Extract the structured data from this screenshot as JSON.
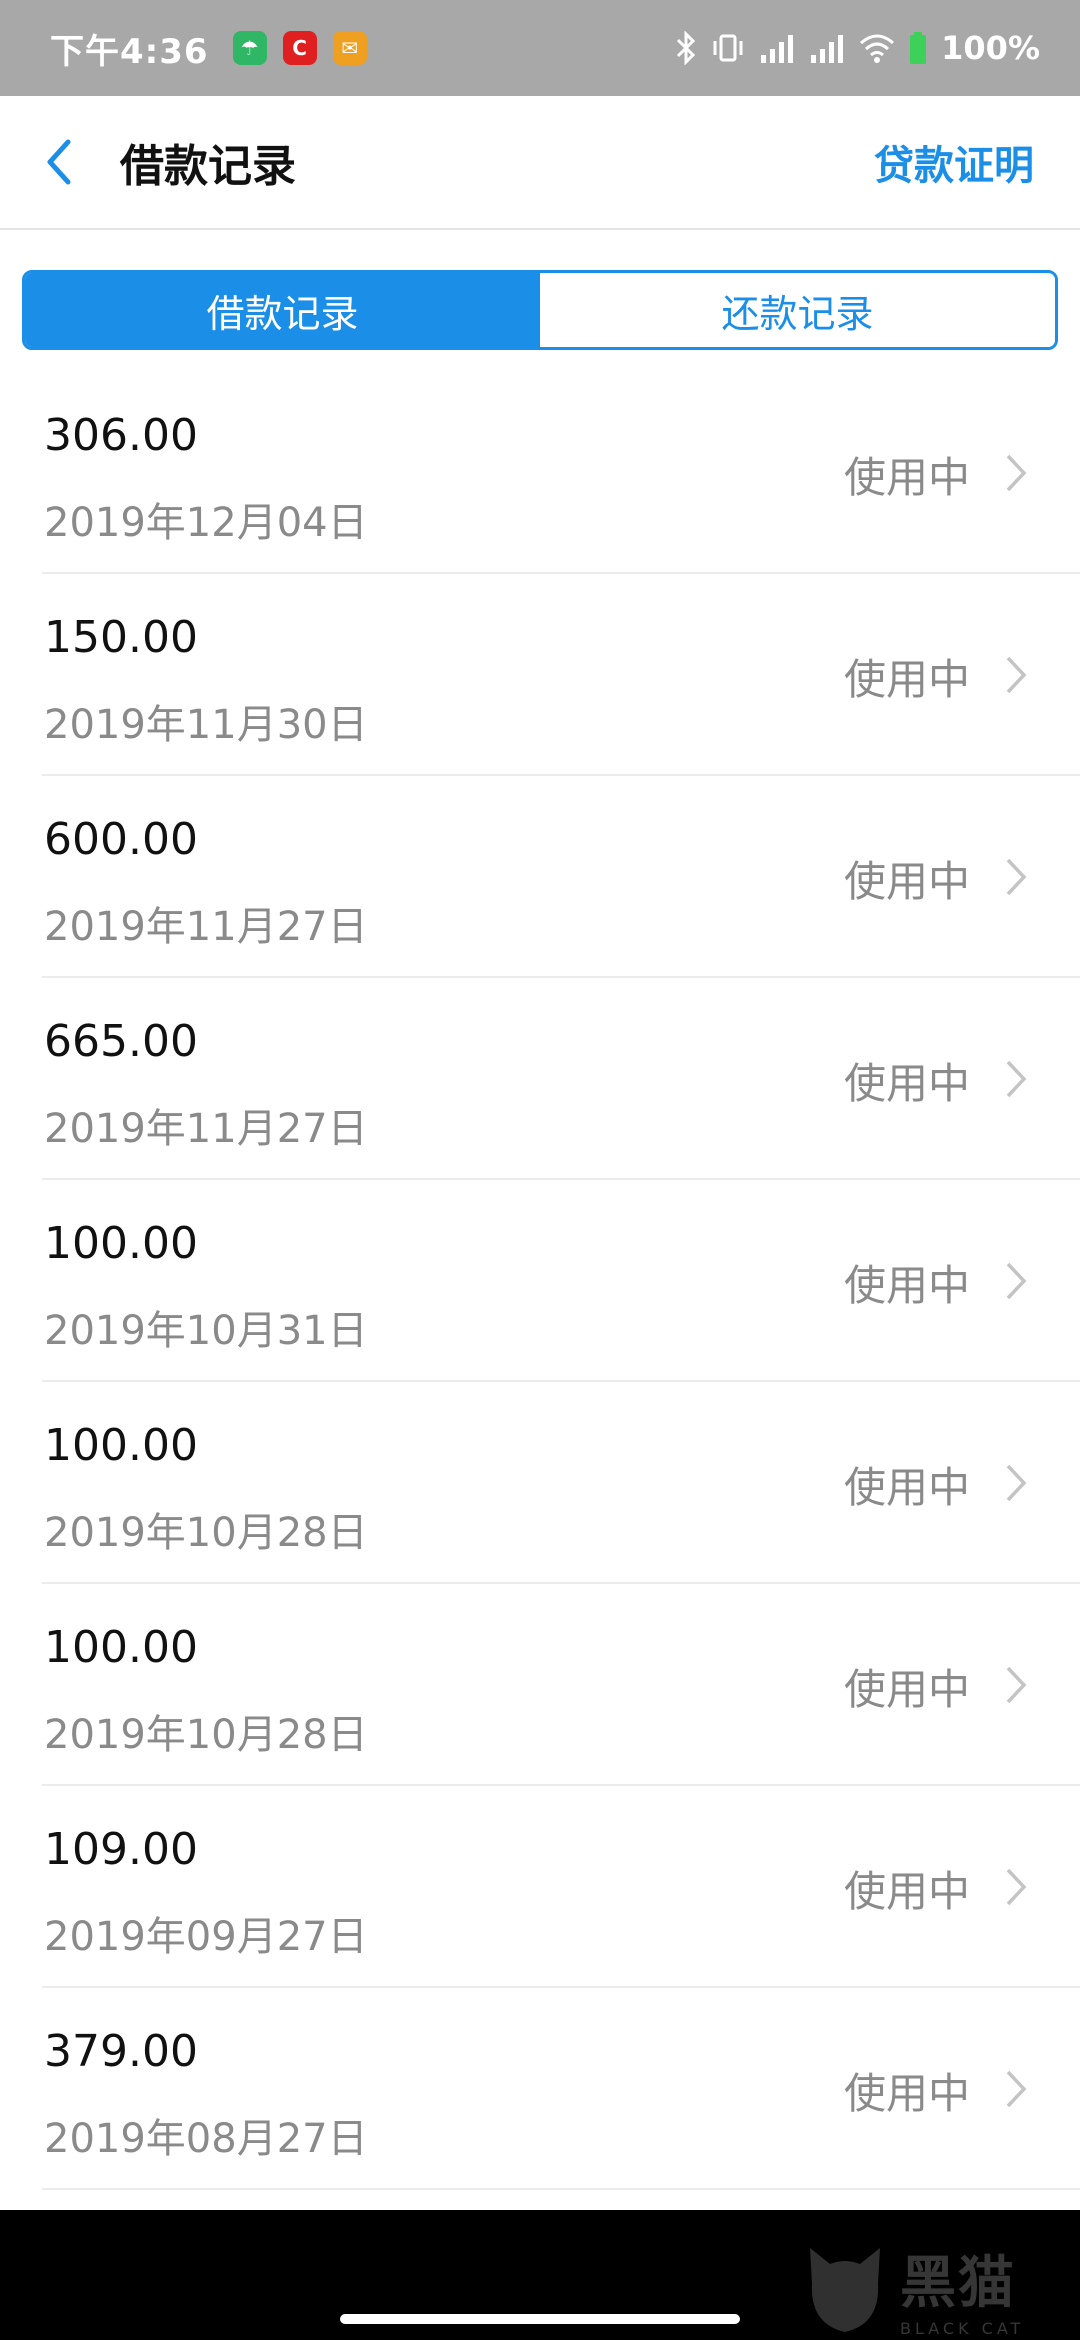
{
  "status_bar": {
    "time": "下午4:36",
    "battery": "100%",
    "apps": [
      {
        "icon": "umbrella-app-icon",
        "color": "#2fb765",
        "glyph": "☂"
      },
      {
        "icon": "c-app-icon",
        "color": "#e02020",
        "glyph": "C"
      },
      {
        "icon": "mail-app-icon",
        "color": "#f0a020",
        "glyph": "✉"
      }
    ]
  },
  "header": {
    "title": "借款记录",
    "action": "贷款证明"
  },
  "tabs": [
    {
      "label": "借款记录",
      "active": true
    },
    {
      "label": "还款记录",
      "active": false
    }
  ],
  "records": [
    {
      "amount": "306.00",
      "date": "2019年12月04日",
      "status": "使用中"
    },
    {
      "amount": "150.00",
      "date": "2019年11月30日",
      "status": "使用中"
    },
    {
      "amount": "600.00",
      "date": "2019年11月27日",
      "status": "使用中"
    },
    {
      "amount": "665.00",
      "date": "2019年11月27日",
      "status": "使用中"
    },
    {
      "amount": "100.00",
      "date": "2019年10月31日",
      "status": "使用中"
    },
    {
      "amount": "100.00",
      "date": "2019年10月28日",
      "status": "使用中"
    },
    {
      "amount": "100.00",
      "date": "2019年10月28日",
      "status": "使用中"
    },
    {
      "amount": "109.00",
      "date": "2019年09月27日",
      "status": "使用中"
    },
    {
      "amount": "379.00",
      "date": "2019年08月27日",
      "status": "使用中"
    }
  ],
  "watermark": {
    "cn": "黑猫",
    "en": "BLACK CAT"
  },
  "colors": {
    "accent": "#1b8ee8",
    "status_bar": "#a8a8a8",
    "muted_text": "#8a8a8a"
  }
}
